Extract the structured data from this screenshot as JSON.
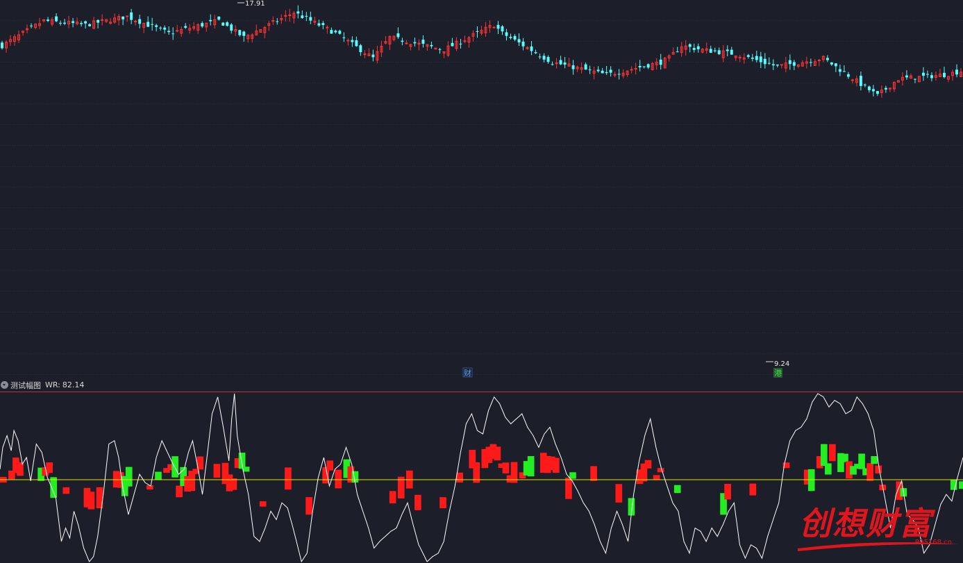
{
  "colors": {
    "background": "#1c1f2a",
    "up": "#ff3333",
    "down": "#54ffff",
    "grid": "#3a3f55",
    "wr_line": "#ffffff",
    "baseline": "#e6e600",
    "bar_up": "#ff1a1a",
    "bar_down": "#22ee22",
    "annotation_cai": "#5aa6ff",
    "annotation_gang": "#4fd44f",
    "separator": "#b23a3a"
  },
  "indicator": {
    "name": "测试幅图",
    "value_label": "WR:",
    "value": "82.14"
  },
  "annotations": {
    "max_label": "17.91",
    "min_label": "9.24",
    "event_1": "财",
    "event_2": "港"
  },
  "watermark": {
    "text": "创想财富",
    "url": "995168.cn"
  },
  "chart_data": [
    {
      "type": "candlestick",
      "title": "",
      "ylim": [
        8.9,
        18.0
      ],
      "price_max": 17.91,
      "price_min": 9.24,
      "shape_keypoints": [
        [
          0,
          16.9
        ],
        [
          10,
          17.5
        ],
        [
          20,
          17.4
        ],
        [
          30,
          17.6
        ],
        [
          40,
          17.2
        ],
        [
          52,
          17.5
        ],
        [
          58,
          17.1
        ],
        [
          70,
          17.7
        ],
        [
          80,
          17.2
        ],
        [
          89,
          16.6
        ],
        [
          93,
          17.1
        ],
        [
          106,
          16.8
        ],
        [
          118,
          17.4
        ],
        [
          120,
          17.2
        ],
        [
          132,
          16.5
        ],
        [
          145,
          16.2
        ],
        [
          158,
          16.5
        ],
        [
          160,
          16.6
        ],
        [
          163,
          16.9
        ],
        [
          168,
          16.8
        ],
        [
          176,
          16.7
        ],
        [
          186,
          16.4
        ],
        [
          197,
          16.6
        ],
        [
          210,
          15.7
        ],
        [
          215,
          16.1
        ],
        [
          226,
          16.2
        ],
        [
          240,
          16.5
        ],
        [
          243,
          16.4
        ],
        [
          254,
          16.5
        ],
        [
          268,
          15.7
        ],
        [
          276,
          15.2
        ],
        [
          280,
          15.6
        ],
        [
          286,
          16.0
        ],
        [
          300,
          16.8
        ],
        [
          310,
          16.9
        ],
        [
          319,
          16.0
        ],
        [
          326,
          16.1
        ],
        [
          334,
          16.7
        ],
        [
          342,
          16.8
        ],
        [
          350,
          16.9
        ],
        [
          362,
          16.3
        ],
        [
          364,
          16.1
        ],
        [
          378,
          16.4
        ],
        [
          379,
          16.3
        ],
        [
          390,
          16.0
        ],
        [
          395,
          15.6
        ],
        [
          403,
          15.3
        ],
        [
          416,
          15.2
        ],
        [
          428,
          15.3
        ],
        [
          440,
          15.2
        ],
        [
          445,
          15.0
        ],
        [
          448,
          14.8
        ],
        [
          450,
          14.7
        ],
        [
          459,
          14.6
        ],
        [
          462,
          14.4
        ],
        [
          466,
          14.2
        ],
        [
          468,
          14.5
        ],
        [
          470,
          14.9
        ],
        [
          478,
          15.0
        ],
        [
          484,
          15.0
        ],
        [
          490,
          15.5
        ],
        [
          494,
          15.2
        ],
        [
          496,
          15.6
        ],
        [
          500,
          15.8
        ],
        [
          504,
          16.0
        ],
        [
          506,
          16.2
        ],
        [
          512,
          16.3
        ],
        [
          516,
          16.1
        ],
        [
          522,
          16.2
        ],
        [
          530,
          16.3
        ],
        [
          536,
          15.9
        ],
        [
          540,
          15.6
        ],
        [
          545,
          15.8
        ],
        [
          550,
          15.3
        ],
        [
          555,
          14.9
        ],
        [
          558,
          15.1
        ],
        [
          562,
          14.3
        ],
        [
          564,
          13.8
        ],
        [
          568,
          14.3
        ],
        [
          570,
          13.8
        ],
        [
          573,
          13.3
        ],
        [
          578,
          13.2
        ],
        [
          580,
          12.9
        ],
        [
          583,
          12.4
        ],
        [
          585,
          11.9
        ],
        [
          587,
          11.2
        ],
        [
          589,
          10.6
        ],
        [
          592,
          9.9
        ],
        [
          594,
          9.5
        ],
        [
          596,
          9.35
        ],
        [
          599,
          9.8
        ],
        [
          602,
          10.4
        ],
        [
          604,
          10.9
        ],
        [
          608,
          11.3
        ],
        [
          612,
          11.4
        ],
        [
          614,
          11.8
        ],
        [
          616,
          11.5
        ],
        [
          620,
          12.2
        ],
        [
          624,
          12.6
        ],
        [
          628,
          12.9
        ],
        [
          632,
          13.3
        ],
        [
          636,
          13.6
        ],
        [
          640,
          13.8
        ],
        [
          646,
          13.9
        ],
        [
          648,
          13.5
        ],
        [
          652,
          13.2
        ],
        [
          655,
          13.4
        ],
        [
          660,
          13.1
        ],
        [
          664,
          12.6
        ],
        [
          668,
          12.7
        ],
        [
          672,
          13.1
        ],
        [
          676,
          13.0
        ],
        [
          680,
          12.8
        ],
        [
          684,
          12.4
        ],
        [
          688,
          12.7
        ],
        [
          690,
          12.4
        ]
      ]
    },
    {
      "type": "line",
      "title": "",
      "series": [
        {
          "name": "WR",
          "last_value": 82.14
        }
      ],
      "baseline_level": 50,
      "ylim": [
        0,
        100
      ],
      "wr_keypoints": [
        [
          0,
          55
        ],
        [
          2,
          68
        ],
        [
          5,
          75
        ],
        [
          8,
          66
        ],
        [
          10,
          78
        ],
        [
          13,
          72
        ],
        [
          16,
          58
        ],
        [
          19,
          62
        ],
        [
          22,
          48
        ],
        [
          26,
          70
        ],
        [
          30,
          65
        ],
        [
          34,
          50
        ],
        [
          40,
          38
        ],
        [
          44,
          12
        ],
        [
          47,
          20
        ],
        [
          50,
          14
        ],
        [
          53,
          30
        ],
        [
          56,
          22
        ],
        [
          60,
          8
        ],
        [
          64,
          0
        ],
        [
          67,
          3
        ],
        [
          70,
          15
        ],
        [
          74,
          40
        ],
        [
          78,
          70
        ],
        [
          82,
          72
        ],
        [
          85,
          62
        ],
        [
          88,
          44
        ],
        [
          92,
          28
        ],
        [
          96,
          40
        ],
        [
          100,
          52
        ],
        [
          104,
          47
        ],
        [
          108,
          45
        ],
        [
          112,
          62
        ],
        [
          116,
          72
        ],
        [
          120,
          65
        ],
        [
          124,
          58
        ],
        [
          128,
          52
        ],
        [
          132,
          55
        ],
        [
          135,
          65
        ],
        [
          138,
          72
        ],
        [
          142,
          55
        ],
        [
          145,
          40
        ],
        [
          148,
          60
        ],
        [
          152,
          88
        ],
        [
          156,
          98
        ],
        [
          160,
          80
        ],
        [
          164,
          60
        ],
        [
          166,
          85
        ],
        [
          168,
          100
        ],
        [
          170,
          75
        ],
        [
          174,
          55
        ],
        [
          178,
          40
        ],
        [
          182,
          15
        ],
        [
          186,
          12
        ],
        [
          190,
          20
        ],
        [
          194,
          30
        ],
        [
          198,
          25
        ],
        [
          202,
          35
        ],
        [
          206,
          32
        ],
        [
          210,
          20
        ],
        [
          213,
          10
        ],
        [
          216,
          0
        ],
        [
          220,
          5
        ],
        [
          224,
          30
        ],
        [
          228,
          50
        ],
        [
          232,
          62
        ],
        [
          236,
          45
        ],
        [
          240,
          55
        ],
        [
          244,
          58
        ],
        [
          248,
          68
        ],
        [
          252,
          58
        ],
        [
          256,
          40
        ],
        [
          260,
          30
        ],
        [
          264,
          20
        ],
        [
          268,
          8
        ],
        [
          272,
          12
        ],
        [
          276,
          15
        ],
        [
          280,
          18
        ],
        [
          284,
          20
        ],
        [
          288,
          28
        ],
        [
          292,
          35
        ],
        [
          296,
          22
        ],
        [
          300,
          10
        ],
        [
          303,
          5
        ],
        [
          306,
          0
        ],
        [
          310,
          3
        ],
        [
          314,
          5
        ],
        [
          318,
          12
        ],
        [
          322,
          30
        ],
        [
          326,
          45
        ],
        [
          330,
          65
        ],
        [
          334,
          82
        ],
        [
          338,
          88
        ],
        [
          342,
          78
        ],
        [
          346,
          76
        ],
        [
          350,
          90
        ],
        [
          354,
          98
        ],
        [
          358,
          94
        ],
        [
          362,
          86
        ],
        [
          366,
          82
        ],
        [
          370,
          85
        ],
        [
          374,
          88
        ],
        [
          378,
          80
        ],
        [
          382,
          75
        ],
        [
          386,
          68
        ],
        [
          390,
          76
        ],
        [
          394,
          80
        ],
        [
          398,
          70
        ],
        [
          402,
          62
        ],
        [
          406,
          52
        ],
        [
          410,
          48
        ],
        [
          414,
          42
        ],
        [
          418,
          35
        ],
        [
          422,
          30
        ],
        [
          426,
          22
        ],
        [
          430,
          12
        ],
        [
          434,
          5
        ],
        [
          438,
          20
        ],
        [
          442,
          30
        ],
        [
          446,
          22
        ],
        [
          450,
          12
        ],
        [
          454,
          40
        ],
        [
          458,
          60
        ],
        [
          462,
          75
        ],
        [
          466,
          85
        ],
        [
          470,
          68
        ],
        [
          474,
          55
        ],
        [
          478,
          45
        ],
        [
          482,
          35
        ],
        [
          486,
          30
        ],
        [
          490,
          12
        ],
        [
          494,
          5
        ],
        [
          498,
          20
        ],
        [
          502,
          18
        ],
        [
          506,
          12
        ],
        [
          510,
          20
        ],
        [
          514,
          15
        ],
        [
          518,
          22
        ],
        [
          522,
          30
        ],
        [
          526,
          35
        ],
        [
          530,
          10
        ],
        [
          534,
          2
        ],
        [
          538,
          10
        ],
        [
          542,
          8
        ],
        [
          546,
          2
        ],
        [
          550,
          15
        ],
        [
          554,
          25
        ],
        [
          558,
          35
        ],
        [
          562,
          58
        ],
        [
          566,
          72
        ],
        [
          570,
          78
        ],
        [
          574,
          80
        ],
        [
          578,
          85
        ],
        [
          582,
          95
        ],
        [
          586,
          100
        ],
        [
          590,
          98
        ],
        [
          594,
          92
        ],
        [
          598,
          96
        ],
        [
          602,
          94
        ],
        [
          606,
          88
        ],
        [
          610,
          90
        ],
        [
          614,
          98
        ],
        [
          618,
          94
        ],
        [
          622,
          88
        ],
        [
          626,
          78
        ],
        [
          630,
          55
        ],
        [
          634,
          38
        ],
        [
          638,
          20
        ],
        [
          642,
          40
        ],
        [
          646,
          48
        ],
        [
          650,
          28
        ],
        [
          654,
          25
        ],
        [
          658,
          20
        ],
        [
          662,
          5
        ],
        [
          666,
          10
        ],
        [
          670,
          22
        ],
        [
          674,
          34
        ],
        [
          678,
          40
        ],
        [
          682,
          36
        ],
        [
          686,
          50
        ],
        [
          690,
          62
        ]
      ],
      "bars_description": "Per-bar up/down boxes drawn around the baseline on the lower panel"
    }
  ]
}
